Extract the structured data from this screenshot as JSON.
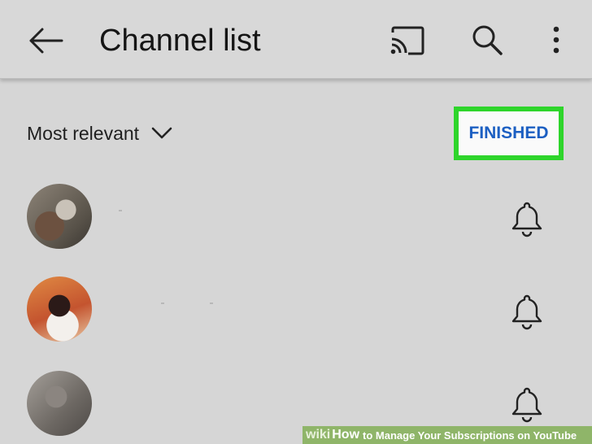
{
  "header": {
    "title": "Channel list",
    "icons": [
      "back-arrow-icon",
      "cast-icon",
      "search-icon",
      "more-vert-icon"
    ]
  },
  "sort": {
    "label": "Most relevant",
    "icon": "chevron-down-icon"
  },
  "actions": {
    "finished_label": "FINISHED",
    "highlight_color": "#2ed52b",
    "label_color": "#1c5fc2"
  },
  "channels": [
    {
      "avatar": "avatar-1",
      "icon": "bell-icon"
    },
    {
      "avatar": "avatar-2",
      "icon": "bell-icon"
    },
    {
      "avatar": "avatar-3",
      "icon": "bell-icon"
    }
  ],
  "footer": {
    "wiki": "wiki",
    "how": "How",
    "title": "to Manage Your Subscriptions on YouTube"
  }
}
